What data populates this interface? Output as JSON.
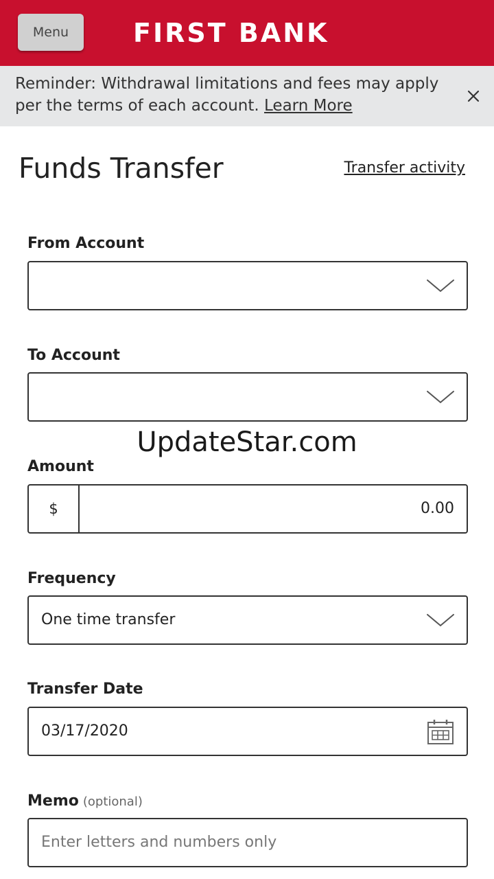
{
  "header": {
    "menu_label": "Menu",
    "brand": "FIRST BANK",
    "brand_color": "#c8102e"
  },
  "banner": {
    "text": "Reminder: Withdrawal limitations and fees may apply per the terms of each account.",
    "link_label": "Learn More",
    "close_icon": "close-icon"
  },
  "page": {
    "title": "Funds Transfer",
    "activity_link": "Transfer activity"
  },
  "form": {
    "from_account": {
      "label": "From Account",
      "value": ""
    },
    "to_account": {
      "label": "To Account",
      "value": ""
    },
    "amount": {
      "label": "Amount",
      "currency": "$",
      "value": "0.00"
    },
    "frequency": {
      "label": "Frequency",
      "value": "One time transfer"
    },
    "transfer_date": {
      "label": "Transfer Date",
      "value": "03/17/2020",
      "icon": "calendar-icon"
    },
    "memo": {
      "label": "Memo",
      "optional": "(optional)",
      "placeholder": "Enter letters and numbers only"
    }
  },
  "watermark": "UpdateStar.com"
}
